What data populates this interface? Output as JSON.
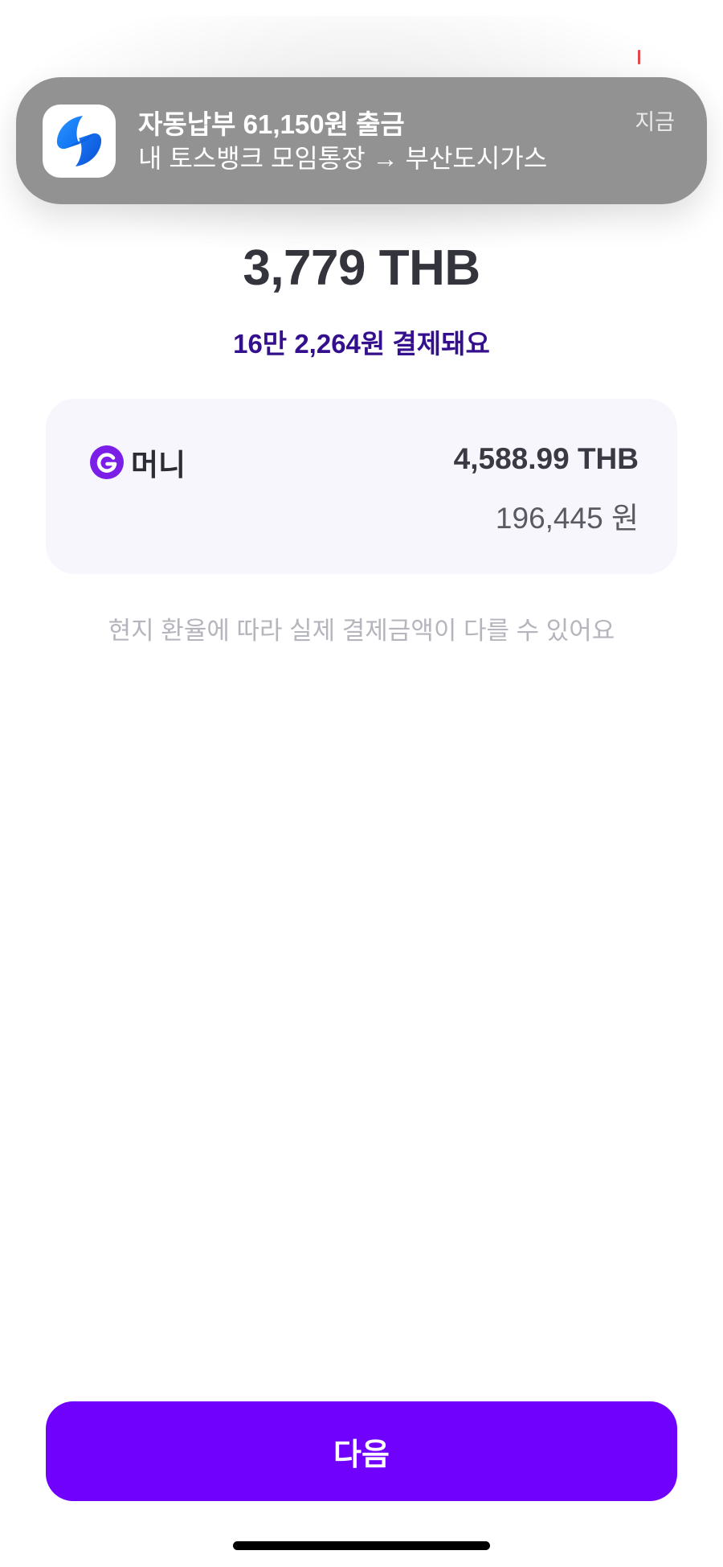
{
  "notification": {
    "app_icon": "toss-bank-icon",
    "title": "자동납부 61,150원 출금",
    "body": "내 토스뱅크 모임통장 → 부산도시가스",
    "time": "지금"
  },
  "payment": {
    "amount": "3,779 THB",
    "charge_note": "16만 2,264원 결제돼요"
  },
  "balance_card": {
    "logo_icon": "g-money-logo-icon",
    "label": "머니",
    "balance_thb": "4,588.99 THB",
    "balance_krw": "196,445 원"
  },
  "disclaimer": "현지 환율에 따라 실제 결제금액이 다를 수 있어요",
  "buttons": {
    "next_label": "다음"
  },
  "colors": {
    "accent": "#7001fd",
    "charge_note": "#34108e",
    "notification_bg": "#929292",
    "card_bg": "#f7f6fd",
    "status_mark": "#e5484d"
  }
}
